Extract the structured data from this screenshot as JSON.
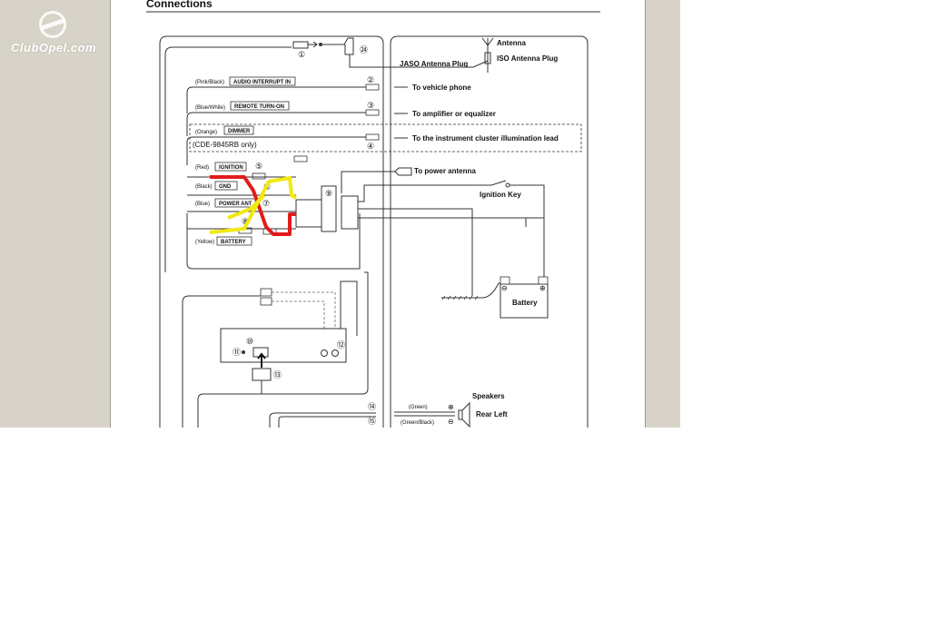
{
  "logo": {
    "text": "ClubOpel.com"
  },
  "diagram": {
    "title": "Connections",
    "antenna": {
      "label": "Antenna",
      "iso_plug": "ISO Antenna Plug",
      "jaso_plug": "JASO Antenna Plug",
      "num_main": "①",
      "num_jaso": "㉔"
    },
    "wires": [
      {
        "color": "(Pink/Black)",
        "name": "AUDIO INTERRUPT IN",
        "num": "②",
        "dest": "To vehicle phone"
      },
      {
        "color": "(Blue/White)",
        "name": "REMOTE TURN-ON",
        "num": "③",
        "dest": "To amplifier or equalizer"
      },
      {
        "color": "(Orange)",
        "name": "DIMMER",
        "num": "④",
        "dest": "To the instrument cluster illumination lead",
        "model_note": "(CDE-9845RB only)"
      }
    ],
    "power": {
      "ignition": {
        "color": "(Red)",
        "name": "IGNITION",
        "num": "⑤"
      },
      "gnd": {
        "color": "(Black)",
        "name": "GND",
        "num": "⑥"
      },
      "power_ant": {
        "color": "(Blue)",
        "name": "POWER ANT",
        "num": "⑦",
        "dest": "To power antenna"
      },
      "battery": {
        "color": "(Yellow)",
        "name": "BATTERY",
        "num": "⑧"
      },
      "connector_num": "⑨"
    },
    "ignition_key": "Ignition Key",
    "battery_box": {
      "label": "Battery",
      "minus": "⊖",
      "plus": "⊕"
    },
    "head_unit": {
      "n10": "⑩",
      "n11": "⑪",
      "n12": "⑫",
      "n13": "⑬"
    },
    "speakers": {
      "title": "Speakers",
      "rear_left": "Rear Left",
      "green": "(Green)",
      "green_black": "(Green/Black)",
      "n14": "⑭",
      "n15": "⑮",
      "plus": "⊕",
      "minus": "⊖"
    }
  }
}
